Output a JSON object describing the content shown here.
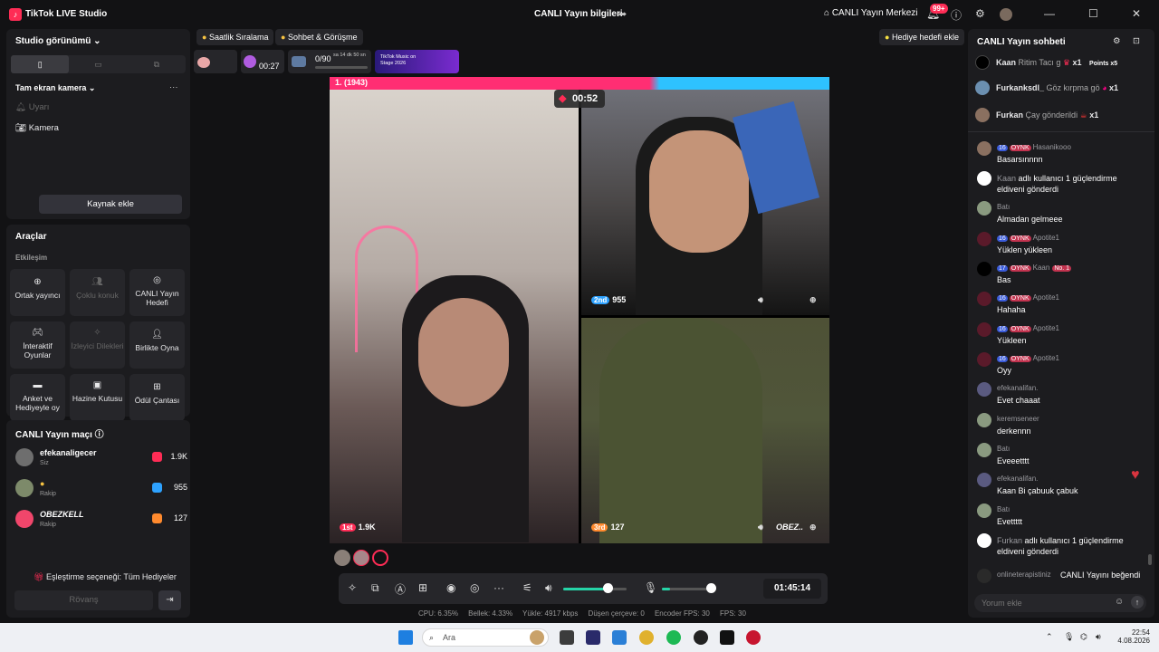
{
  "app": {
    "name": "TikTok LIVE Studio",
    "center_title": "CANLI Yayın bilgileri",
    "live_center": "CANLI Yayın Merkezi",
    "notif_count": "99+"
  },
  "studio": {
    "title": "Studio görünümü",
    "camera_header": "Tam ekran kamera",
    "sources": [
      "Uyarı",
      "Kamera"
    ],
    "add_source": "Kaynak ekle"
  },
  "tools": {
    "title": "Araçlar",
    "section": "Etkileşim",
    "items": [
      "Ortak yayıncı",
      "Çoklu konuk",
      "CANLI Yayın Hedefi",
      "İnteraktif Oyunlar",
      "İzleyici Dilekleri",
      "Birlikte Oyna",
      "Anket ve Hediyeyle oy",
      "Hazine Kutusu",
      "Ödül Çantası"
    ]
  },
  "match": {
    "title": "CANLI Yayın maçı",
    "rows": [
      {
        "name": "efekanaligecer",
        "sub": "Siz",
        "score": "1.9K"
      },
      {
        "name": "",
        "sub": "Rakip",
        "score": "955"
      },
      {
        "name": "OBEZKELL",
        "sub": "Rakip",
        "score": "127"
      }
    ],
    "pairing": "Eşleştirme seçeneği: Tüm Hediyeler",
    "rematch": "Rövanş"
  },
  "pills": {
    "ranking": "Saatlik Sıralama",
    "chat_call": "Sohbet & Görüşme",
    "gift_goal": "Hediye hedefi ekle"
  },
  "chips": {
    "timer": "00:27",
    "progress": "0/90",
    "progress_sub": "sa 14 dk 50 sn",
    "banner": "TikTok Music on Stage 2026"
  },
  "stage": {
    "rank_label": "1. (1943)",
    "timer": "00:52",
    "p1": {
      "rank": "1st",
      "score": "1.9K"
    },
    "p2": {
      "rank": "2nd",
      "score": "955"
    },
    "p3": {
      "rank": "3rd",
      "score": "127",
      "name": "OBEZ.."
    }
  },
  "controls": {
    "clock": "01:45:14",
    "mic_level": 0.15,
    "volume_level": 0.7
  },
  "stats": {
    "cpu": "CPU: 6.35%",
    "mem": "Bellek: 4.33%",
    "upload": "Yükle: 4917 kbps",
    "dropped": "Düşen çerçeve: 0",
    "encoder": "Encoder FPS: 30",
    "fps": "FPS: 30"
  },
  "chat": {
    "title": "CANLI Yayın sohbeti",
    "gifts": [
      {
        "user": "Kaan",
        "text": "Ritim Tacı g",
        "count": "x1",
        "extra": "Points x5"
      },
      {
        "user": "Furkanksdl_",
        "text": "Göz kırpma gö",
        "count": "x1"
      },
      {
        "user": "Furkan",
        "text": "Çay gönderildi",
        "count": "x1"
      }
    ],
    "messages": [
      {
        "lv": "16",
        "fan": "OYNK",
        "user": "Hasanikooo",
        "text": "Basarsınnnn"
      },
      {
        "lv": "",
        "fan": "",
        "user": "Kaan",
        "text": "adlı kullanıcı 1 güçlendirme eldiveni gönderdi"
      },
      {
        "lv": "",
        "fan": "",
        "user": "Batı",
        "text": "Almadan gelmeee"
      },
      {
        "lv": "16",
        "fan": "OYNK",
        "user": "Apotite1",
        "text": "Yüklen yükleen"
      },
      {
        "lv": "17",
        "fan": "OYNK",
        "user": "Kaan",
        "text": "Bas"
      },
      {
        "lv": "16",
        "fan": "OYNK",
        "user": "Apotite1",
        "text": "Hahaha"
      },
      {
        "lv": "16",
        "fan": "OYNK",
        "user": "Apotite1",
        "text": "Yükleen"
      },
      {
        "lv": "16",
        "fan": "OYNK",
        "user": "Apotite1",
        "text": "Oyy"
      },
      {
        "lv": "",
        "fan": "",
        "user": "efekanalifan.",
        "text": "Evet chaaat"
      },
      {
        "lv": "",
        "fan": "",
        "user": "keremseneer",
        "text": "derkennn"
      },
      {
        "lv": "",
        "fan": "",
        "user": "Batı",
        "text": "Eveeetttt"
      },
      {
        "lv": "",
        "fan": "",
        "user": "efekanalifan.",
        "text": "Kaan Bi çabuuk çabuk"
      },
      {
        "lv": "",
        "fan": "",
        "user": "Batı",
        "text": "Evettttt"
      },
      {
        "lv": "",
        "fan": "",
        "user": "Furkan",
        "text": "adlı kullanıcı 1 güçlendirme eldiveni gönderdi"
      },
      {
        "lv": "",
        "fan": "",
        "user": "onlineterapistiniz",
        "text": "CANLI Yayını beğendi"
      }
    ],
    "placeholder": "Yorum ekle",
    "kaan_badge": "No. 1"
  },
  "taskbar": {
    "search": "Ara",
    "time": "22:54",
    "date": "4.08.2026"
  },
  "colors": {
    "accent": "#fe2c55",
    "blue": "#2ec2ff"
  }
}
